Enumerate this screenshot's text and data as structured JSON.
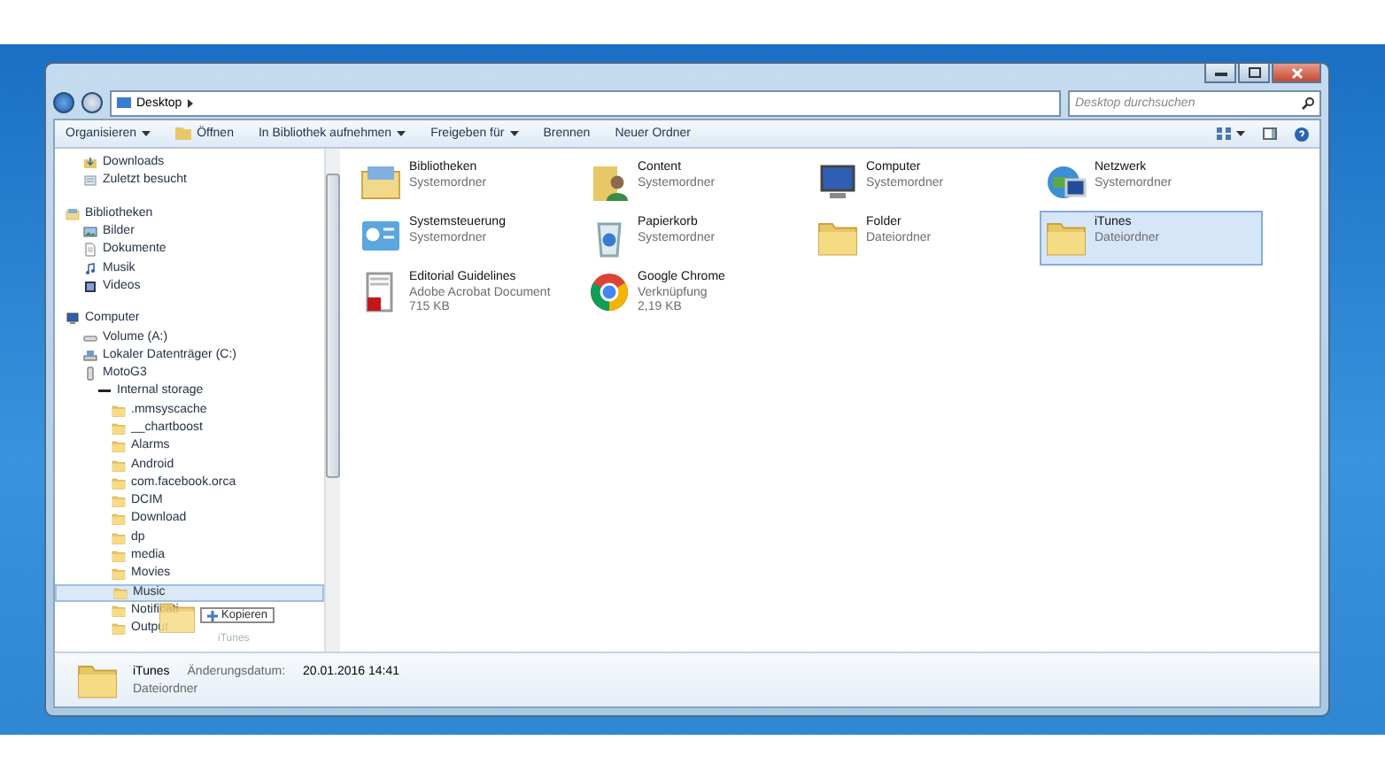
{
  "address": {
    "path": "Desktop"
  },
  "search": {
    "placeholder": "Desktop durchsuchen"
  },
  "toolbar": [
    {
      "label": "Organisieren",
      "kind": "menu"
    },
    {
      "label": "Öffnen",
      "kind": "open"
    },
    {
      "label": "In Bibliothek aufnehmen",
      "kind": "menu"
    },
    {
      "label": "Freigeben für",
      "kind": "menu"
    },
    {
      "label": "Brennen",
      "kind": "plain"
    },
    {
      "label": "Neuer Ordner",
      "kind": "plain"
    }
  ],
  "sidebar": {
    "groups": [
      {
        "items": [
          {
            "label": "Downloads",
            "kind": "download",
            "selected": false
          },
          {
            "label": "Zuletzt besucht",
            "kind": "recent",
            "selected": false
          }
        ]
      },
      {
        "label": "Bibliotheken",
        "kind": "library",
        "items": [
          {
            "label": "Bilder",
            "kind": "pictures",
            "selected": false
          },
          {
            "label": "Dokumente",
            "kind": "documents",
            "selected": false
          },
          {
            "label": "Musik",
            "kind": "music",
            "selected": false
          },
          {
            "label": "Videos",
            "kind": "video",
            "selected": false
          }
        ]
      },
      {
        "label": "Computer",
        "kind": "computer",
        "items": [
          {
            "label": "Volume (A:)",
            "kind": "drive",
            "selected": false
          },
          {
            "label": "Lokaler Datenträger (C:)",
            "kind": "disk",
            "selected": false
          },
          {
            "label": "MotoG3",
            "kind": "phone",
            "selected": false,
            "children": [
              {
                "label": "Internal storage",
                "kind": "storage",
                "selected": false,
                "children": [
                  {
                    "label": ".mmsyscache",
                    "kind": "folder",
                    "selected": false
                  },
                  {
                    "label": "__chartboost",
                    "kind": "folder",
                    "selected": false
                  },
                  {
                    "label": "Alarms",
                    "kind": "folder",
                    "selected": false
                  },
                  {
                    "label": "Android",
                    "kind": "folder",
                    "selected": false
                  },
                  {
                    "label": "com.facebook.orca",
                    "kind": "folder",
                    "selected": false
                  },
                  {
                    "label": "DCIM",
                    "kind": "folder",
                    "selected": false
                  },
                  {
                    "label": "Download",
                    "kind": "folder",
                    "selected": false
                  },
                  {
                    "label": "dp",
                    "kind": "folder",
                    "selected": false
                  },
                  {
                    "label": "media",
                    "kind": "folder",
                    "selected": false
                  },
                  {
                    "label": "Movies",
                    "kind": "folder",
                    "selected": false
                  },
                  {
                    "label": "Music",
                    "kind": "folder",
                    "selected": true
                  },
                  {
                    "label": "Notificati",
                    "kind": "folder",
                    "selected": false
                  },
                  {
                    "label": "Output",
                    "kind": "folder",
                    "selected": false
                  }
                ]
              }
            ]
          }
        ]
      }
    ]
  },
  "drag": {
    "label": "iTunes",
    "action": "Kopieren"
  },
  "items": [
    {
      "name": "Bibliotheken",
      "type": "Systemordner",
      "kind": "library",
      "selected": false
    },
    {
      "name": "Content",
      "type": "Systemordner",
      "kind": "user",
      "selected": false
    },
    {
      "name": "Computer",
      "type": "Systemordner",
      "kind": "computer",
      "selected": false
    },
    {
      "name": "Netzwerk",
      "type": "Systemordner",
      "kind": "network",
      "selected": false
    },
    {
      "name": "Systemsteuerung",
      "type": "Systemordner",
      "kind": "control",
      "selected": false
    },
    {
      "name": "Papierkorb",
      "type": "Systemordner",
      "kind": "recycle",
      "selected": false
    },
    {
      "name": "Folder",
      "type": "Dateiordner",
      "kind": "folder",
      "selected": false
    },
    {
      "name": "iTunes",
      "type": "Dateiordner",
      "kind": "folder",
      "selected": true
    },
    {
      "name": "Editorial Guidelines",
      "type": "Adobe Acrobat Document",
      "size": "715 KB",
      "kind": "pdf",
      "selected": false
    },
    {
      "name": "Google Chrome",
      "type": "Verknüpfung",
      "size": "2,19 KB",
      "kind": "chrome",
      "selected": false
    }
  ],
  "details": {
    "name": "iTunes",
    "type": "Dateiordner",
    "date_label": "Änderungsdatum:",
    "date": "20.01.2016 14:41"
  }
}
